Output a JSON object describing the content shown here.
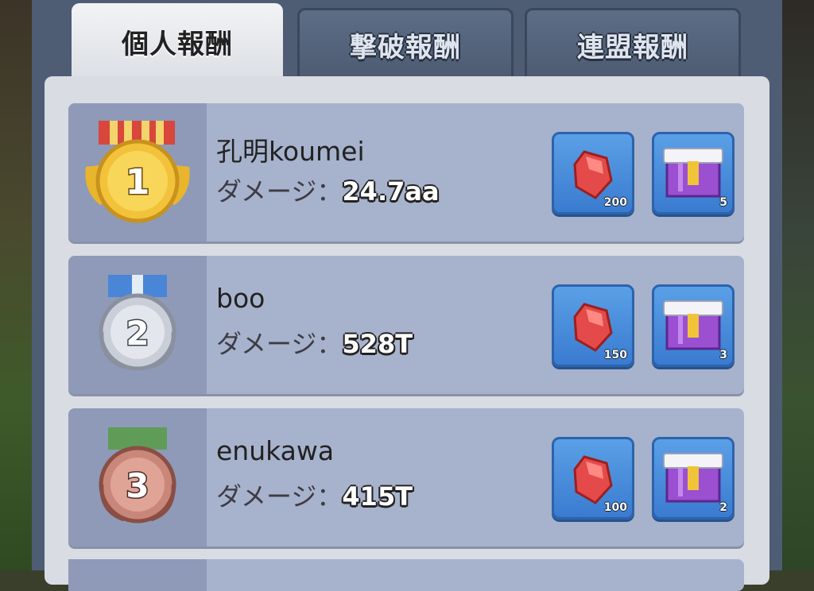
{
  "tabs": [
    {
      "label": "個人報酬",
      "active": true
    },
    {
      "label": "撃破報酬",
      "active": false
    },
    {
      "label": "連盟報酬",
      "active": false
    }
  ],
  "damage_label": "ダメージ：",
  "rows": [
    {
      "rank": "1",
      "medal": "gold-medal",
      "name": "孔明koumei",
      "damage": "24.7aa",
      "gem_count": "200",
      "box_count": "5"
    },
    {
      "rank": "2",
      "medal": "silver-medal",
      "name": "boo",
      "damage": "528T",
      "gem_count": "150",
      "box_count": "3"
    },
    {
      "rank": "3",
      "medal": "bronze-medal",
      "name": "enukawa",
      "damage": "415T",
      "gem_count": "100",
      "box_count": "2"
    }
  ],
  "colors": {
    "gold": "#f2c23a",
    "silver": "#b9c0cc",
    "bronze": "#c9877a",
    "gem": "#e44a4a",
    "box": "#9b4fd1"
  }
}
